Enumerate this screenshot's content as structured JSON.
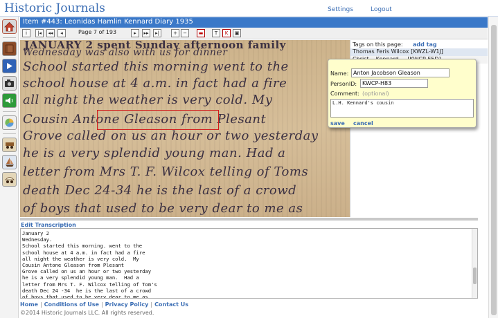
{
  "header": {
    "brand": "Historic Journals",
    "settings": "Settings",
    "logout": "Logout"
  },
  "sidebar": {
    "items": [
      {
        "name": "home",
        "glyph": "⌂"
      },
      {
        "name": "journals",
        "glyph": "▮"
      },
      {
        "name": "play",
        "glyph": "▶"
      },
      {
        "name": "camera",
        "glyph": "◉"
      },
      {
        "name": "audio",
        "glyph": "♪"
      },
      {
        "name": "chart",
        "glyph": "◔"
      },
      {
        "name": "cart",
        "glyph": "⛟"
      },
      {
        "name": "ship",
        "glyph": "⛵"
      },
      {
        "name": "wagon",
        "glyph": "⛟"
      }
    ]
  },
  "item": {
    "title": "Item #443: Leonidas Hamlin Kennard Diary 1935",
    "page_label": "Page 7 of 193"
  },
  "document": {
    "handwriting": [
      "JANUARY 2  spent Sunday afternoon family",
      "Wednesday        was also with us for dinner",
      "School started this morning went to the",
      "school house at 4 a.m. in fact had a fire",
      "all night the weather is very cold. My",
      "Cousin Antone Gleason from Plesant",
      "Grove called on us an hour or two yesterday",
      "he is a very splendid young man. Had a",
      "letter from Mrs T. F. Wilcox telling of Toms",
      "death Dec 24-34 he is the last of a crowd",
      "of boys that used to be very dear to me as"
    ]
  },
  "tags": {
    "title": "Tags on this page:",
    "add_label": "add tag",
    "rows": [
      "Thomas Feris Wilcox [KWZL-W1J]",
      "Christ... Kennard ... [KWCP-F5D]"
    ]
  },
  "popup": {
    "name_label": "Name:",
    "name_value": "Anton Jacobson Gleason",
    "person_label": "PersonID:",
    "person_value": "KWCP-H83",
    "comment_label": "Comment:",
    "comment_hint": "(optional)",
    "comment_value": "L.H. Kennard's cousin",
    "save": "save",
    "cancel": "cancel"
  },
  "transcription": {
    "heading": "Edit Transcription",
    "lines": [
      "January 2",
      "Wednesday.",
      "School started this morning. went to the",
      "school house at 4 a.m. in fact had a fire",
      "all night the weather is very cold.  My",
      "Cousin Antone Gleason from Plesant",
      "Grove called on us an hour or two yesterday",
      "he is a very splendid young man.  Had a",
      "letter from Mrs T. F. Wilcox telling of Tom's",
      "death Dec 24 -34  he is the last of a crowd",
      "of boys that used to be very dear to me as"
    ]
  },
  "footer": {
    "links": [
      "Home",
      "Conditions of Use",
      "Privacy Policy",
      "Contact Us"
    ],
    "copyright": "©2014 Historic Journals LLC.   All rights reserved."
  },
  "colors": {
    "accent": "#3a78c8",
    "link": "#3a6db4",
    "highlight": "#d21a1a",
    "popup_bg": "#fffecc"
  }
}
